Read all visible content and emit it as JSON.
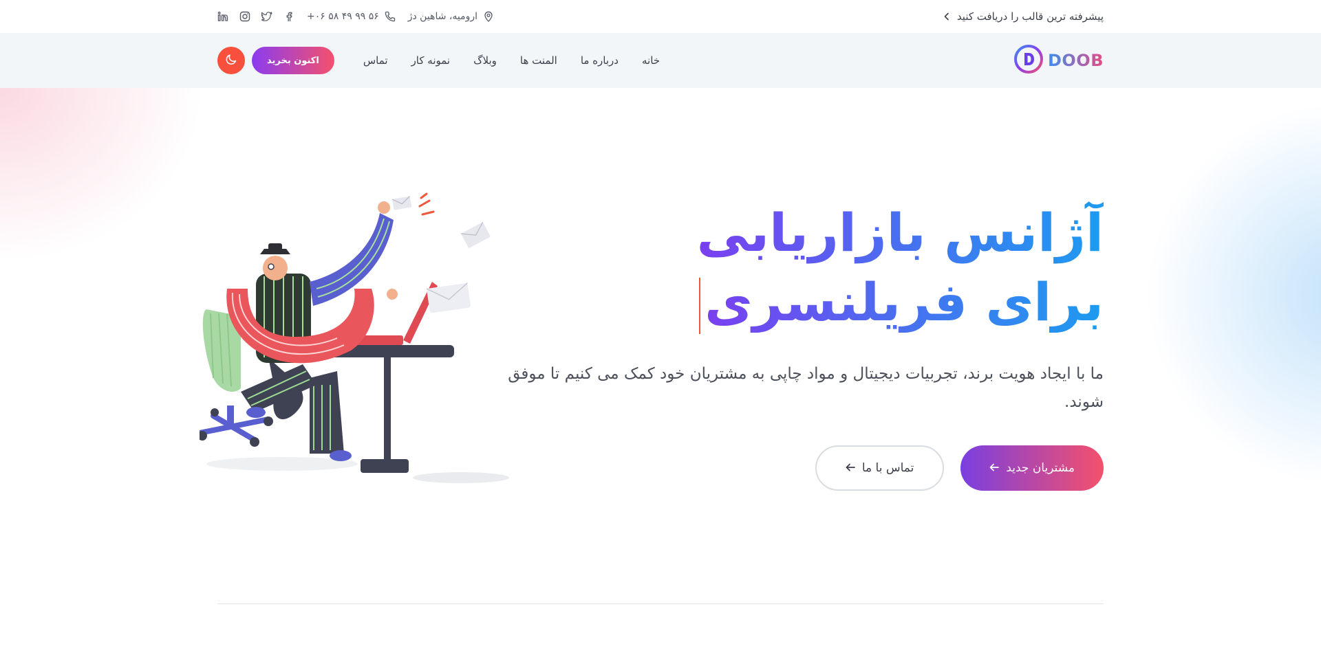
{
  "topbar": {
    "promo_text": "پیشرفته ترین قالب را دریافت کنید",
    "address": "ارومیه، شاهین دژ",
    "phone": "+۰۶ ۵۸ ۴۹ ۹۹ ۵۶",
    "social_icons": [
      "facebook-icon",
      "twitter-icon",
      "instagram-icon",
      "linkedin-icon"
    ]
  },
  "header": {
    "logo_text": "DOOB",
    "nav": [
      "خانه",
      "درباره ما",
      "المنت ها",
      "وبلاگ",
      "نمونه کار",
      "تماس"
    ],
    "buy_label": "اکنون بخرید"
  },
  "hero": {
    "title_line1": "آژانس بازاریابی",
    "title_line2": "برای فریلنسری",
    "description": "ما با ایجاد هویت برند، تجربیات دیجیتال و مواد چاپی به مشتریان خود کمک می کنیم تا موفق شوند.",
    "primary_button": "مشتریان جدید",
    "secondary_button": "تماس با ما"
  },
  "colors": {
    "accent_red": "#f9503d",
    "gradient_purple": "#7a3fe0",
    "gradient_pink": "#f4516c",
    "gradient_blue": "#1d9bf0"
  }
}
